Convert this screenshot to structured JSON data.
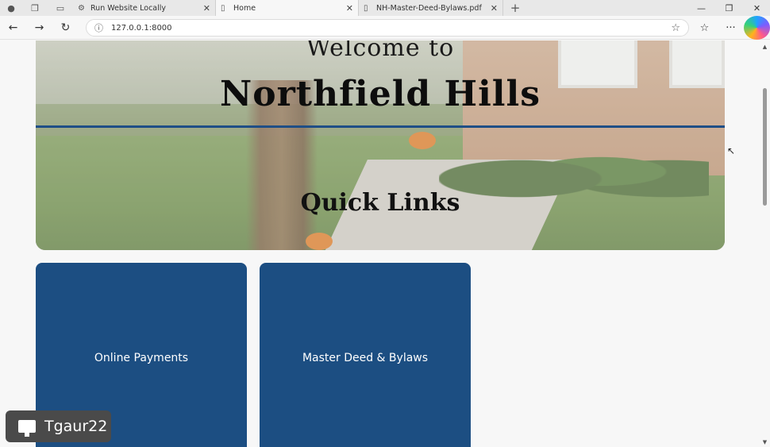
{
  "browser": {
    "tabs": [
      {
        "title": "Run Website Locally",
        "icon": "settings-icon"
      },
      {
        "title": "Home",
        "icon": "page-icon"
      },
      {
        "title": "NH-Master-Deed-Bylaws.pdf",
        "icon": "page-icon"
      }
    ],
    "active_tab": 1,
    "address": "127.0.0.1:8000"
  },
  "page": {
    "hero_welcome": "Welcome to",
    "hero_title": "Northfield Hills",
    "quick_links_heading": "Quick Links",
    "cards": [
      {
        "label": "Online Payments"
      },
      {
        "label": "Master Deed & Bylaws"
      }
    ],
    "accent_color": "#1c4e82"
  },
  "user_badge": {
    "label": "Tgaur22"
  }
}
